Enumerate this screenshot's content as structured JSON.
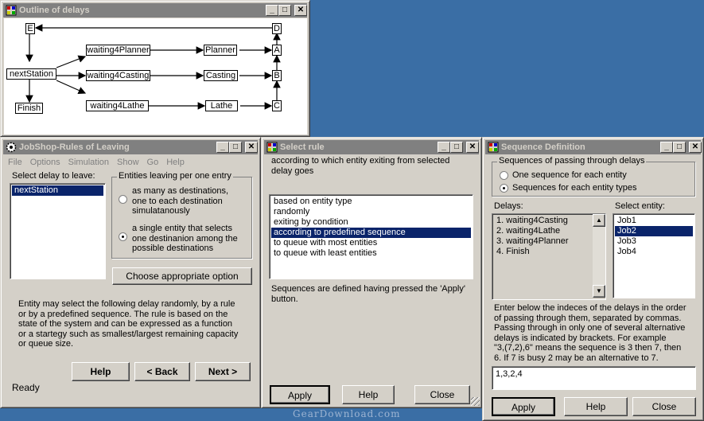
{
  "outline": {
    "title": "Outline of delays",
    "nodes": {
      "E": "E",
      "D": "D",
      "A": "A",
      "B": "B",
      "C": "C",
      "next": "nextStation",
      "finish": "Finish",
      "w_planner": "waiting4Planner",
      "w_casting": "waiting4Casting",
      "w_lathe": "waiting4Lathe",
      "planner": "Planner",
      "casting": "Casting",
      "lathe": "Lathe"
    }
  },
  "rules": {
    "title": "JobShop-Rules of Leaving",
    "menu": [
      "File",
      "Options",
      "Simulation",
      "Show",
      "Go",
      "Help"
    ],
    "select_label": "Select delay to leave:",
    "delays": [
      "nextStation"
    ],
    "group_label": "Entities leaving per one entry",
    "radio1": [
      "as many as destinations,",
      "one to each destination",
      "simulatanously"
    ],
    "radio2": [
      "a single entity that selects",
      "one destinanion among the",
      "possible destinations"
    ],
    "choose_btn": "Choose appropriate option",
    "description": [
      "Entity may select the following delay randomly, by a rule",
      "or by a predefined sequence. The rule is based on the",
      "state of the system and can be expressed as a function",
      "or a startegy  such  as smallest/largest remaining capacity",
      "or queue size."
    ],
    "help": "Help",
    "back": "< Back",
    "next": "Next >",
    "status": "Ready"
  },
  "select_rule": {
    "title": "Select rule",
    "heading": [
      "according to which entity exiting from selected",
      "delay goes"
    ],
    "options": [
      "based on entity type",
      "randomly",
      "exiting by condition",
      "according to predefined sequence",
      "to queue with most entities",
      "to queue with least entities"
    ],
    "selected_index": 3,
    "note": [
      "Sequences are defined having pressed the 'Apply'",
      "button."
    ],
    "apply": "Apply",
    "help": "Help",
    "close": "Close"
  },
  "sequence": {
    "title": "Sequence Definition",
    "group_label": "Sequences of passing through delays",
    "radio1": "One sequence for each entity",
    "radio2": "Sequences for each entity types",
    "delays_label": "Delays:",
    "delays": [
      "1. waiting4Casting",
      "2. waiting4Lathe",
      "3. waiting4Planner",
      "4. Finish"
    ],
    "entity_label": "Select entity:",
    "entities": [
      "Job1",
      "Job2",
      "Job3",
      "Job4"
    ],
    "selected_entity": 1,
    "instructions": [
      "Enter below the indeces of the delays in the order",
      "of passing through them, separated by commas.",
      "Passing through in only one of several alternative",
      "delays is indicated by brackets. For example",
      "\"3,(7,2),6\" means the sequence is 3 then 7, then",
      "6. If 7 is busy 2 may be an alternative to 7."
    ],
    "input_value": "1,3,2,4",
    "apply": "Apply",
    "help": "Help",
    "close": "Close"
  },
  "titlebar": {
    "min": "_",
    "max": "□",
    "close": "✕"
  },
  "watermark": "GearDownload.com"
}
